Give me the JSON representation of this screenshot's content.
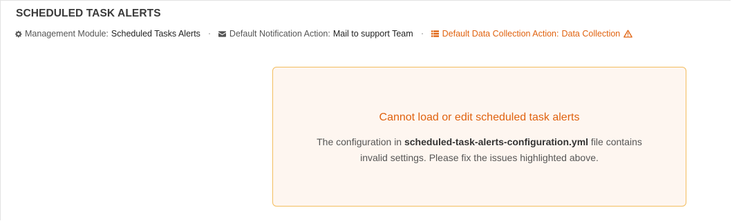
{
  "header": {
    "title": "SCHEDULED TASK ALERTS"
  },
  "meta": {
    "module": {
      "icon": "gear-icon",
      "label": "Management Module:",
      "value": "Scheduled Tasks Alerts"
    },
    "notification": {
      "icon": "envelope-icon",
      "label": "Default Notification Action:",
      "value": "Mail to support Team"
    },
    "data_collection": {
      "icon": "list-icon",
      "label": "Default Data Collection Action:",
      "value": "Data Collection",
      "status_icon": "warning-triangle-icon"
    }
  },
  "error": {
    "title": "Cannot load or edit scheduled task alerts",
    "message_prefix": "The configuration in ",
    "filename": "scheduled-task-alerts-configuration.yml",
    "message_line1_suffix": " file contains",
    "message_line2": "invalid settings. Please fix the issues highlighted above."
  },
  "colors": {
    "warning_text": "#e0620f",
    "card_border": "#f3bd5e",
    "card_background": "#fef6f0",
    "title_text": "#3a3a3a"
  }
}
